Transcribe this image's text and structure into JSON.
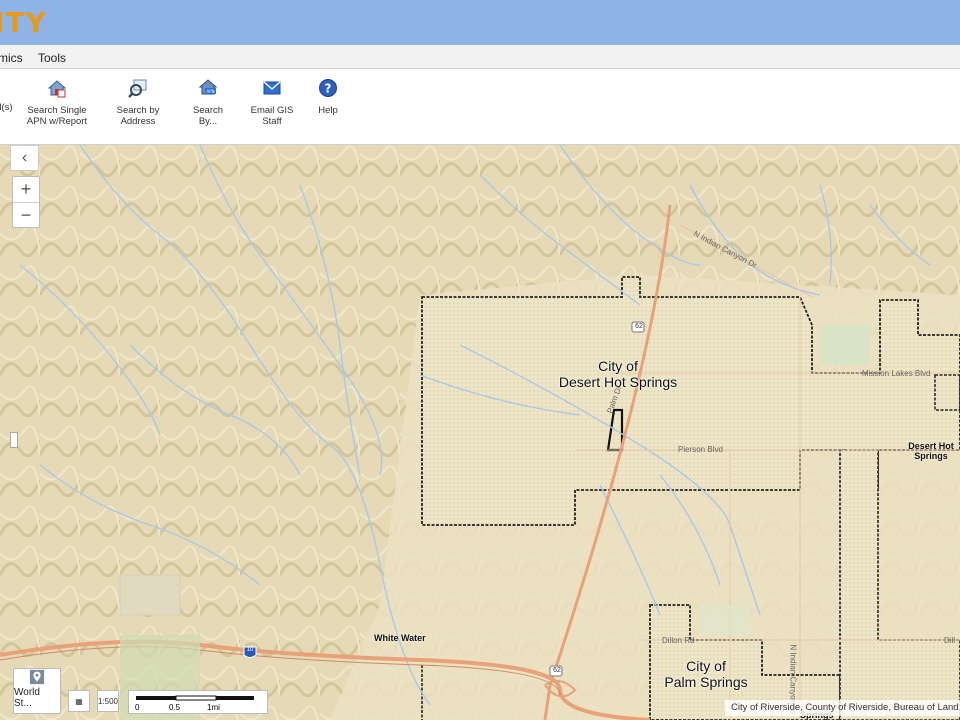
{
  "app": {
    "logo_text": "ITY"
  },
  "menu": {
    "items": [
      "mics",
      "Tools"
    ]
  },
  "toolbar": {
    "items": [
      {
        "label": "l(s)",
        "icon": "search-parcels-icon"
      },
      {
        "label": "Search Single APN w/Report",
        "icon": "house-report-icon"
      },
      {
        "label": "Search by Address",
        "icon": "magnify-address-icon"
      },
      {
        "label": "Search By...",
        "icon": "house-search-icon"
      },
      {
        "label": "Email GIS Staff",
        "icon": "email-icon"
      },
      {
        "label": "Help",
        "icon": "help-icon"
      }
    ]
  },
  "map": {
    "controls": {
      "collapse": "‹",
      "zoom_in": "+",
      "zoom_out": "−"
    },
    "labels": {
      "dhs_city": "City of\nDesert Hot Springs",
      "dhs_small": "Desert Hot\nSprings",
      "ps_city": "City of\nPalm Springs",
      "white_water": "White Water",
      "route62_a": "62",
      "route62_b": "62",
      "interstate": "10",
      "n_indian_canyon_top": "N Indian Canyon Dr",
      "n_indian_canyon_vert": "N Indian Canyon Dr",
      "mission_lakes": "Mission Lakes Blvd",
      "pierson": "Pierson Blvd",
      "dillon": "Dillon Rd",
      "dillon_right": "Dill",
      "palm_dr": "Palm Dr",
      "springs_bottom": "Springs"
    },
    "colors": {
      "terrain": "#e9dfbf",
      "city_fill": "#efe6c8",
      "highway": "#e8a27a",
      "water": "#a9c8e8",
      "boundary": "#333333"
    }
  },
  "bottom": {
    "basemap_label": "World St...",
    "btn_a": "▦",
    "btn_b": "1:500",
    "scale": {
      "t0": "0",
      "t1": "0.5",
      "t2": "1mi"
    },
    "attribution": "City of Riverside, County of Riverside, Bureau of Land M"
  }
}
